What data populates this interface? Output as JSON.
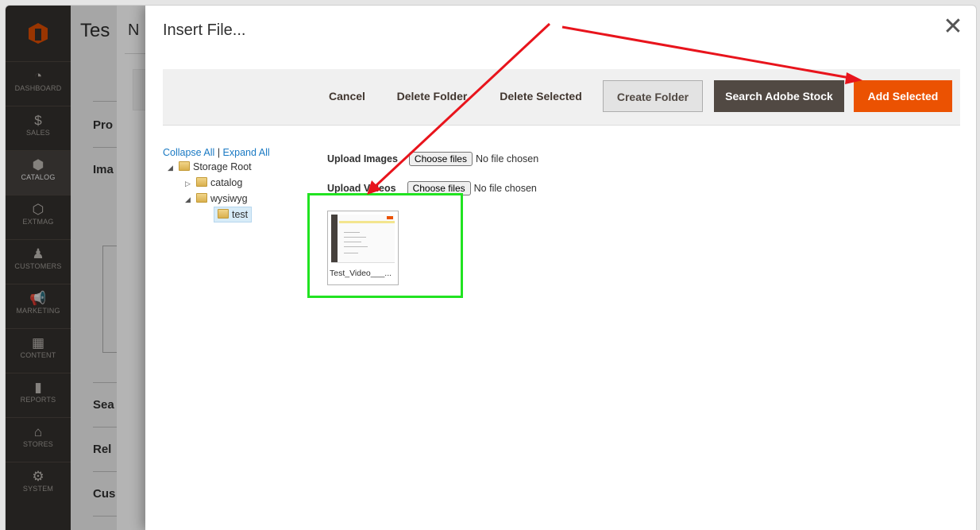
{
  "sidebar": {
    "items": [
      {
        "label": "DASHBOARD",
        "icon": "dashboard-icon",
        "glyph": "◔"
      },
      {
        "label": "SALES",
        "icon": "dollar-icon",
        "glyph": "$"
      },
      {
        "label": "CATALOG",
        "icon": "catalog-box-icon",
        "glyph": "⬢"
      },
      {
        "label": "EXTMAG",
        "icon": "extmag-icon",
        "glyph": "⬡"
      },
      {
        "label": "CUSTOMERS",
        "icon": "customers-icon",
        "glyph": "♟"
      },
      {
        "label": "MARKETING",
        "icon": "megaphone-icon",
        "glyph": "📢"
      },
      {
        "label": "CONTENT",
        "icon": "content-icon",
        "glyph": "▦"
      },
      {
        "label": "REPORTS",
        "icon": "reports-icon",
        "glyph": "▮"
      },
      {
        "label": "STORES",
        "icon": "stores-icon",
        "glyph": "⌂"
      },
      {
        "label": "SYSTEM",
        "icon": "gear-icon",
        "glyph": "⚙"
      }
    ],
    "active_index": 2,
    "accent": "#eb5202"
  },
  "page": {
    "title": "Tes",
    "sections": [
      "Pro",
      "Ima",
      "Sea",
      "Rel",
      "Cus"
    ]
  },
  "modal2": {
    "title": "N"
  },
  "modal": {
    "title": "Insert File...",
    "close_glyph": "✕",
    "toolbar": {
      "cancel": "Cancel",
      "delete_folder": "Delete Folder",
      "delete_selected": "Delete Selected",
      "create_folder": "Create Folder",
      "search_stock": "Search Adobe Stock",
      "add_selected": "Add Selected"
    },
    "tree": {
      "collapse_all": "Collapse All",
      "separator": "|",
      "expand_all": "Expand All",
      "root": "Storage Root",
      "nodes": [
        "catalog",
        "wysiwyg",
        "test"
      ]
    },
    "upload_images": {
      "label": "Upload Images",
      "button": "Choose files",
      "status": "No file chosen"
    },
    "upload_videos": {
      "label": "Upload Videos",
      "button": "Choose files",
      "status": "No file chosen"
    },
    "file": {
      "name": "Test_Video___..."
    }
  },
  "colors": {
    "highlight": "#21e321",
    "annotation_arrow": "#e8141c",
    "primary_button": "#eb5202",
    "dark_button": "#514943"
  }
}
